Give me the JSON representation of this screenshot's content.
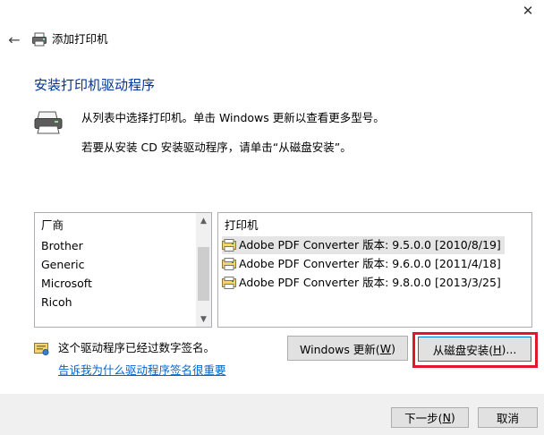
{
  "window": {
    "close_glyph": "✕",
    "back_glyph": "←",
    "title": "添加打印机"
  },
  "heading": "安装打印机驱动程序",
  "description": {
    "line1": "从列表中选择打印机。单击 Windows 更新以查看更多型号。",
    "line2": "若要从安装 CD 安装驱动程序，请单击“从磁盘安装”。"
  },
  "manufacturers": {
    "header": "厂商",
    "items": [
      "Brother",
      "Generic",
      "Microsoft",
      "Ricoh"
    ]
  },
  "printers": {
    "header": "打印机",
    "items": [
      {
        "label": "Adobe PDF Converter 版本: 9.5.0.0 [2010/8/19]",
        "selected": true
      },
      {
        "label": "Adobe PDF Converter 版本: 9.6.0.0 [2011/4/18]",
        "selected": false
      },
      {
        "label": "Adobe PDF Converter 版本: 9.8.0.0 [2013/3/25]",
        "selected": false
      }
    ]
  },
  "signature": {
    "text": "这个驱动程序已经过数字签名。",
    "link": "告诉我为什么驱动程序签名很重要"
  },
  "buttons": {
    "windows_update_prefix": "Windows 更新(",
    "windows_update_key": "W",
    "windows_update_suffix": ")",
    "have_disk_prefix": "从磁盘安装(",
    "have_disk_key": "H",
    "have_disk_suffix": ")...",
    "next_prefix": "下一步(",
    "next_key": "N",
    "next_suffix": ")",
    "cancel": "取消"
  },
  "colors": {
    "heading": "#003399",
    "link": "#0066cc",
    "highlight_box": "#e0182d",
    "focus_border": "#0078d7",
    "footer_bg": "#f0f0f0"
  },
  "icons": {
    "title": "printer-icon",
    "description": "printer-icon",
    "printer_items": "printer-driver-icon",
    "signature": "signed-driver-icon"
  }
}
